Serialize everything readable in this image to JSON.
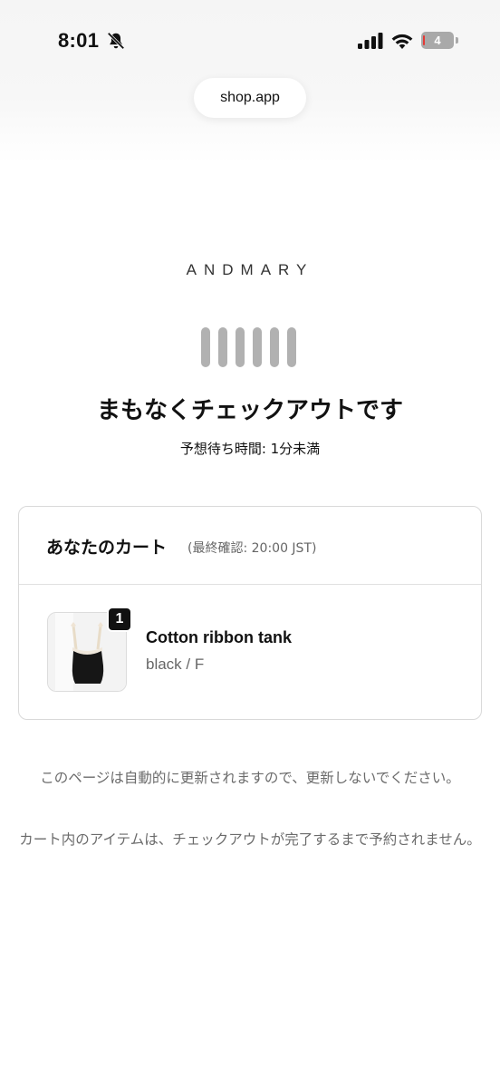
{
  "status_bar": {
    "time": "8:01",
    "battery_level": "4",
    "icons": [
      "bell-off-icon",
      "signal-icon",
      "wifi-icon",
      "battery-icon"
    ]
  },
  "browser": {
    "url": "shop.app"
  },
  "brand": {
    "name": "ANDMARY"
  },
  "queue": {
    "headline": "まもなくチェックアウトです",
    "wait_time": "予想待ち時間: 1分未満"
  },
  "cart": {
    "title": "あなたのカート",
    "last_checked": "(最終確認: 20:00 JST)",
    "items": [
      {
        "quantity": "1",
        "name": "Cotton ribbon tank",
        "variant": "black / F"
      }
    ]
  },
  "notes": {
    "no_refresh": "このページは自動的に更新されますので、更新しないでください。",
    "not_reserved": "カート内のアイテムは、チェックアウトが完了するまで予約されません。"
  },
  "colors": {
    "loader_bar": "#b1b1b1",
    "muted_text": "#6b6b6b",
    "badge": "#111111"
  }
}
